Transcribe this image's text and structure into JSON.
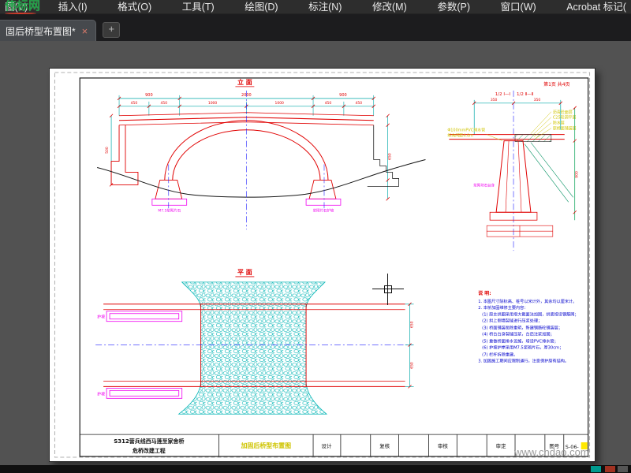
{
  "menu": {
    "items": [
      "图(V)",
      "插入(I)",
      "格式(O)",
      "工具(T)",
      "绘图(D)",
      "标注(N)",
      "修改(M)",
      "参数(P)",
      "窗口(W)",
      "Acrobat 标记("
    ]
  },
  "tabs": {
    "active": "固后桥型布置图*",
    "close": "×",
    "add": "+"
  },
  "logo": {
    "text": "伟标网"
  },
  "canvas": {
    "site_watermark": "www.cndao.com"
  },
  "sheet": {
    "page_info": "第1页 共4页",
    "elevation": {
      "title": "立 面",
      "dims_top": [
        "900",
        "2000",
        "900"
      ],
      "dims_sub": [
        "450",
        "450",
        "1000",
        "1000",
        "450",
        "450"
      ],
      "dim_left": "500",
      "dim_right": "650",
      "label_left": "M7.5浆砌片石",
      "label_right": "浆砌片石护坡"
    },
    "section": {
      "half_left": "1/2 Ⅰ—Ⅰ",
      "half_right": "1/2 Ⅱ—Ⅱ",
      "dims_top": [
        "350",
        "350"
      ],
      "layers": [
        "沥青砼面层",
        "C25砼调平层",
        "防水层",
        "原桥面铺装层"
      ],
      "pipe_line1": "Φ100mmPVC排水管",
      "pipe_line2": "纵向间距4.0m",
      "wall_label": "浆砌块石台身",
      "dim_right": "900"
    },
    "plan": {
      "title": "平 面",
      "label_top": "护坡",
      "label_bottom": "护坡",
      "dim_upper": "650",
      "dim_lower": "650"
    },
    "notes": {
      "title": "说 明:",
      "lines": [
        "1. 本图尺寸除标高、桩号以米计外，其余均以厘米计。",
        "2. 本桥加固维修主要内容：",
        "(1) 原主拱圈采用增大截面法加固，拱底增设钢筋网；",
        "(2) 拱上侧墙裂缝进行压浆处理；",
        "(3) 桥面铺装凿除重筑，新建钢筋砼铺装层；",
        "(4) 桥台台身裂缝压浆，台后注浆加固；",
        "(5) 重做桥面排水设施，增设PVC排水管；",
        "(6) 护坡护岸采用M7.5浆砌片石，厚30cm；",
        "(7) 栏杆拆除重建。",
        "3. 加固施工期间应限制通行，注意保护原有结构。"
      ]
    },
    "titleblock": {
      "project_line1": "S312营兵线西马莲至家舍桥",
      "project_line2": "危桥改建工程",
      "drawing_name": "加固后桥型布置图",
      "f_design": "设计",
      "f_check": "复核",
      "f_review": "审核",
      "f_approve": "审定",
      "f_no_label": "图号",
      "f_no_value": "S-06-"
    }
  }
}
